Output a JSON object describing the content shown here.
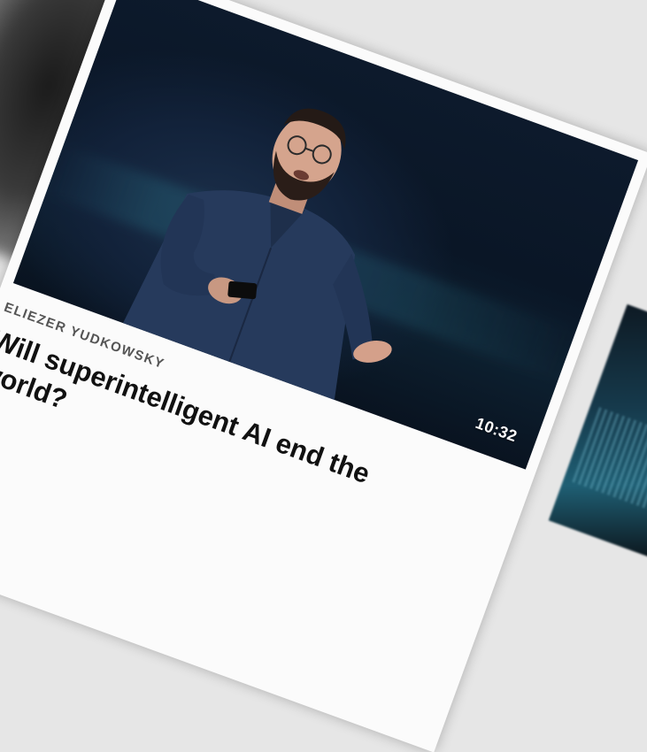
{
  "talk": {
    "speaker": "ELIEZER YUDKOWSKY",
    "title": "Will superintelligent AI end the world?",
    "duration": "10:32"
  },
  "colors": {
    "card": "#fbfbfb",
    "thumbnail_bg": "#0d1a2c",
    "speaker_text": "#555555",
    "title_text": "#111111"
  }
}
